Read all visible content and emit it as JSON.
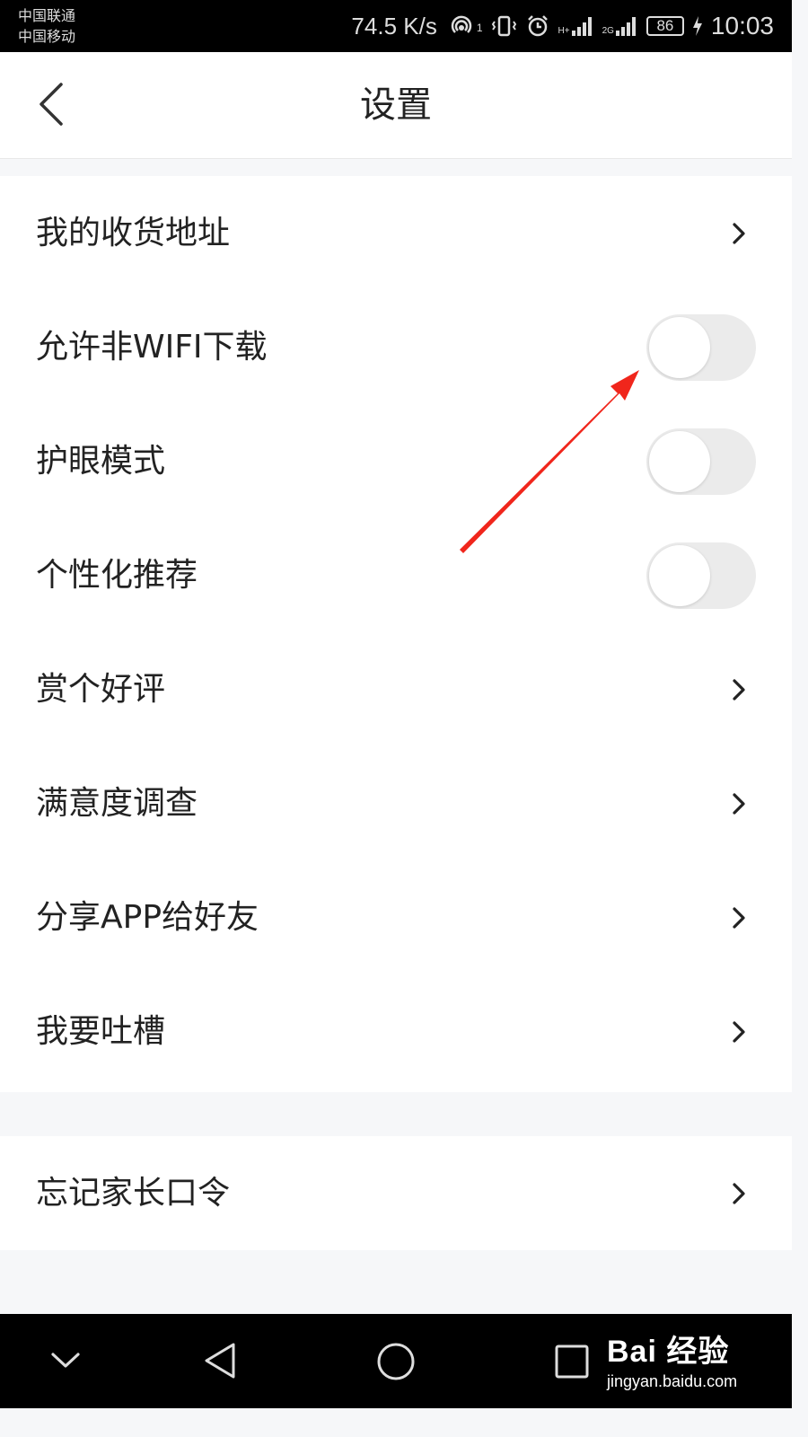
{
  "status_bar": {
    "carrier_1": "中国联通",
    "carrier_2": "中国移动",
    "net_speed": "74.5 K/s",
    "hotspot_badge": "1",
    "signal_1_label": "H+",
    "signal_2_label": "2G",
    "battery": "86",
    "time": "10:03"
  },
  "header": {
    "title": "设置",
    "back_icon": "chevron-left-icon"
  },
  "settings": {
    "items": [
      {
        "label": "我的收货地址",
        "control": "chevron"
      },
      {
        "label": "允许非WIFI下载",
        "control": "toggle",
        "on": false
      },
      {
        "label": "护眼模式",
        "control": "toggle",
        "on": false
      },
      {
        "label": "个性化推荐",
        "control": "toggle",
        "on": false
      },
      {
        "label": "赏个好评",
        "control": "chevron"
      },
      {
        "label": "满意度调查",
        "control": "chevron"
      },
      {
        "label": "分享APP给好友",
        "control": "chevron"
      },
      {
        "label": "我要吐槽",
        "control": "chevron"
      }
    ],
    "footer_items": [
      {
        "label": "忘记家长口令",
        "control": "chevron"
      }
    ]
  },
  "nav_bar": {
    "icons": [
      "chevron-down-icon",
      "back-triangle-icon",
      "home-circle-icon",
      "recents-square-icon"
    ]
  },
  "watermark": {
    "brand": "Bai 经验",
    "url": "jingyan.baidu.com"
  },
  "colors": {
    "annotation_arrow": "#f0261c",
    "toggle_off": "#ebebeb",
    "page_bg": "#f6f7f9"
  }
}
